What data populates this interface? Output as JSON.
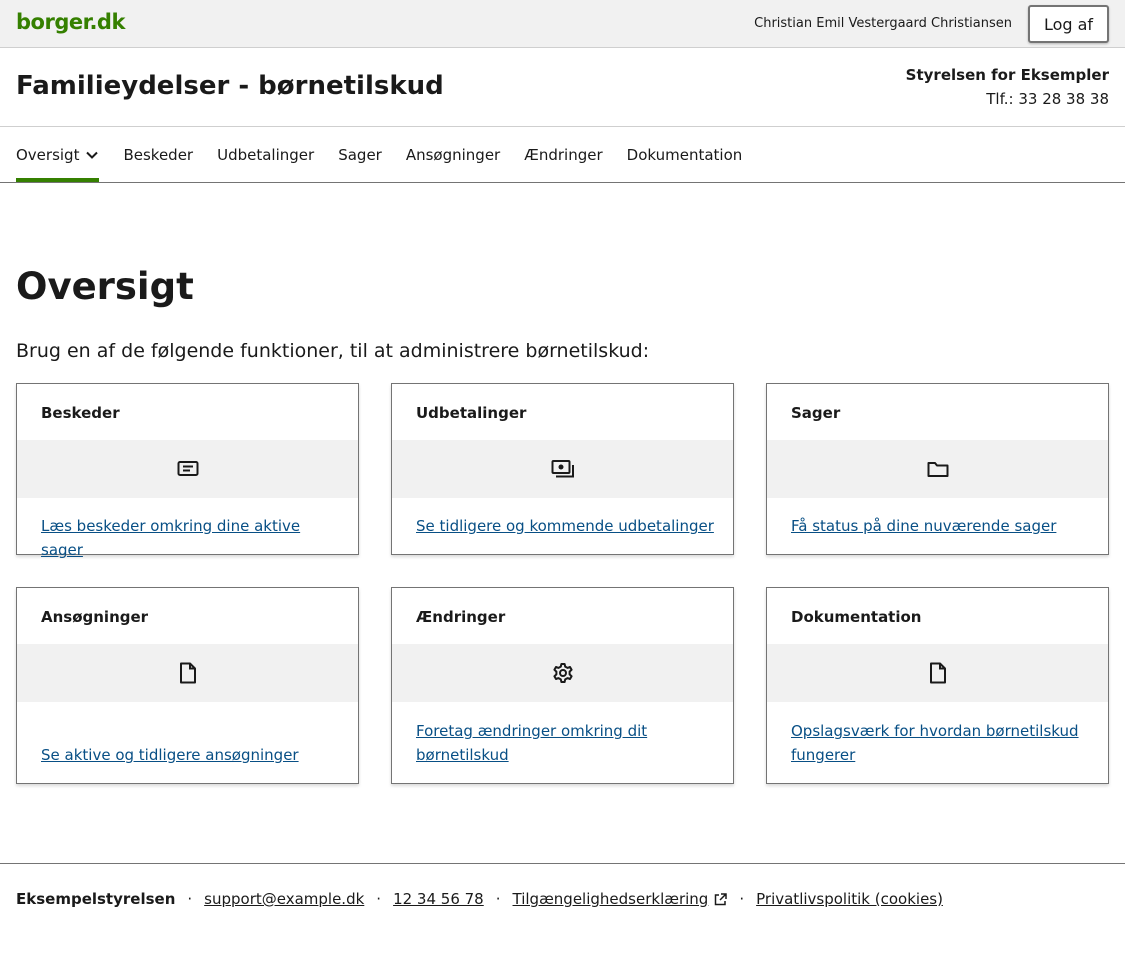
{
  "brand": {
    "logo": "borger.dk",
    "accent": "#358000",
    "link_color": "#084f85"
  },
  "topbar": {
    "username": "Christian Emil Vestergaard Christiansen",
    "logout_label": "Log af"
  },
  "header": {
    "title": "Familieydelser - børnetilskud",
    "agency": "Styrelsen for Eksempler",
    "phone": "Tlf.: 33 28 38 38"
  },
  "nav": {
    "items": [
      {
        "label": "Oversigt",
        "active": true
      },
      {
        "label": "Beskeder"
      },
      {
        "label": "Udbetalinger"
      },
      {
        "label": "Sager"
      },
      {
        "label": "Ansøgninger"
      },
      {
        "label": "Ændringer"
      },
      {
        "label": "Dokumentation"
      }
    ]
  },
  "main": {
    "title": "Oversigt",
    "intro": "Brug en af de følgende funktioner, til at administrere børnetilskud:",
    "cards": [
      {
        "title": "Beskeder",
        "icon": "message-icon",
        "link": "Læs beskeder omkring dine aktive sager"
      },
      {
        "title": "Udbetalinger",
        "icon": "money-icon",
        "link": "Se tidligere og kommende udbetalinger"
      },
      {
        "title": "Sager",
        "icon": "folder-icon",
        "link": "Få status på dine nuværende sager"
      },
      {
        "title": "Ansøgninger",
        "icon": "document-icon",
        "link": "Se aktive og tidligere ansøgninger"
      },
      {
        "title": "Ændringer",
        "icon": "gear-icon",
        "link": "Foretag ændringer omkring dit børnetilskud"
      },
      {
        "title": "Dokumentation",
        "icon": "document-icon",
        "link": "Opslagsværk for hvordan børnetilskud fungerer"
      }
    ]
  },
  "footer": {
    "org": "Eksempelstyrelsen",
    "email": "support@example.dk",
    "phone": "12 34 56 78",
    "accessibility": "Tilgængelighedserklæring",
    "privacy": "Privatlivspolitik (cookies)"
  }
}
